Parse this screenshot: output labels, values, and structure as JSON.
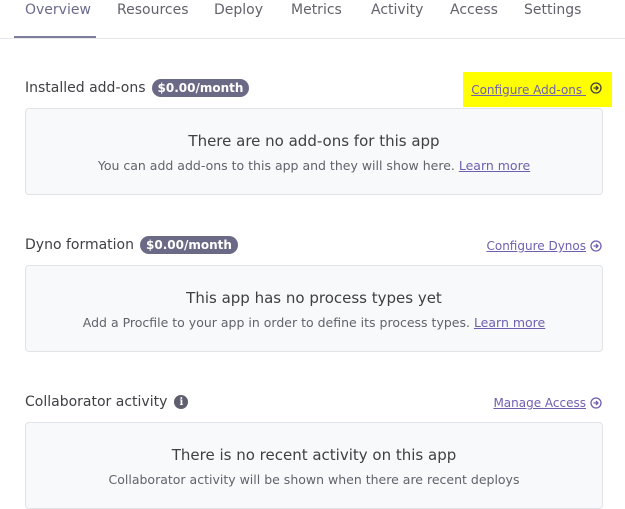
{
  "tabs": [
    {
      "label": "Overview",
      "active": true
    },
    {
      "label": "Resources"
    },
    {
      "label": "Deploy"
    },
    {
      "label": "Metrics"
    },
    {
      "label": "Activity"
    },
    {
      "label": "Access"
    },
    {
      "label": "Settings"
    }
  ],
  "addons": {
    "title": "Installed add-ons",
    "price": "$0.00/month",
    "action": "Configure Add-ons",
    "empty_title": "There are no add-ons for this app",
    "empty_text": "You can add add-ons to this app and they will show here.",
    "learn_more": "Learn more"
  },
  "dynos": {
    "title": "Dyno formation",
    "price": "$0.00/month",
    "action": "Configure Dynos",
    "empty_title": "This app has no process types yet",
    "empty_text": "Add a Procfile to your app in order to define its process types.",
    "learn_more": "Learn more"
  },
  "collab": {
    "title": "Collaborator activity",
    "info_icon": "i",
    "action": "Manage Access",
    "empty_title": "There is no recent activity on this app",
    "empty_text": "Collaborator activity will be shown when there are recent deploys"
  },
  "colors": {
    "accent": "#6f5fb0",
    "badge": "#6b6a86",
    "highlight": "#ffff00"
  }
}
